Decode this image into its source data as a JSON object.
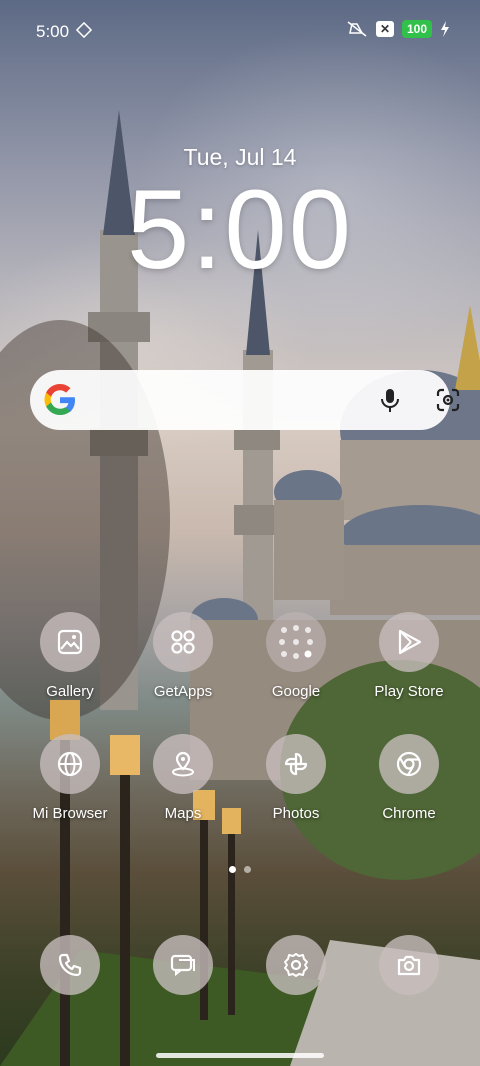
{
  "status_bar": {
    "time": "5:00",
    "battery": "100",
    "icons": [
      "sim-icon",
      "mute-icon",
      "x-notification-icon",
      "charging-icon"
    ]
  },
  "lock_clock": {
    "date": "Tue, Jul 14",
    "time": "5:00"
  },
  "search_widget": {
    "icons": [
      "google-logo-icon",
      "mic-icon",
      "lens-icon"
    ]
  },
  "apps_row1": [
    {
      "label": "Gallery",
      "icon": "gallery-icon"
    },
    {
      "label": "GetApps",
      "icon": "getapps-icon"
    },
    {
      "label": "Google",
      "icon": "folder-icon"
    },
    {
      "label": "Play Store",
      "icon": "play-store-icon"
    }
  ],
  "apps_row2": [
    {
      "label": "Mi Browser",
      "icon": "globe-icon"
    },
    {
      "label": "Maps",
      "icon": "map-pin-icon"
    },
    {
      "label": "Photos",
      "icon": "pinwheel-icon"
    },
    {
      "label": "Chrome",
      "icon": "chrome-icon"
    }
  ],
  "dock": [
    {
      "icon": "phone-icon"
    },
    {
      "icon": "messages-icon"
    },
    {
      "icon": "settings-icon"
    },
    {
      "icon": "camera-icon"
    }
  ],
  "page_indicator": {
    "pages": 2,
    "active": 0
  },
  "colors": {
    "battery": "#31c04a",
    "icon_bg": "#c8bebe"
  }
}
